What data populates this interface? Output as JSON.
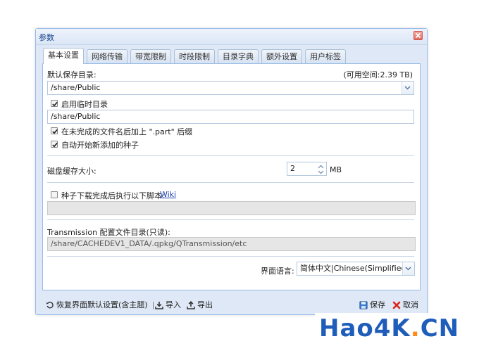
{
  "dialog": {
    "title": "参数"
  },
  "tabs": [
    {
      "label": "基本设置",
      "active": true
    },
    {
      "label": "网络传输",
      "active": false
    },
    {
      "label": "带宽限制",
      "active": false
    },
    {
      "label": "时段限制",
      "active": false
    },
    {
      "label": "目录字典",
      "active": false
    },
    {
      "label": "额外设置",
      "active": false
    },
    {
      "label": "用户标签",
      "active": false
    }
  ],
  "basic": {
    "save_dir_label": "默认保存目录:",
    "free_space": "(可用空间:2.39 TB)",
    "save_dir_value": "/share/Public",
    "temp_dir_label": "启用临时目录",
    "temp_dir_checked": true,
    "temp_dir_value": "/share/Public",
    "part_suffix_label": "在未完成的文件名后加上 \".part\" 后缀",
    "part_suffix_checked": true,
    "auto_start_label": "自动开始新添加的种子",
    "auto_start_checked": true,
    "cache_label": "磁盘缓存大小:",
    "cache_value": "2",
    "cache_unit": "MB",
    "script_label": "种子下载完成后执行以下脚本:",
    "script_checked": false,
    "script_link": "Wiki",
    "script_value": "",
    "config_dir_label": "Transmission 配置文件目录(只读):",
    "config_dir_value": "/share/CACHEDEV1_DATA/.qpkg/QTransmission/etc",
    "language_label": "界面语言:",
    "language_value": "简体中文|Chinese(Simplified)"
  },
  "footer": {
    "reset_label": "恢复界面默认设置(含主题)",
    "import_label": "导入",
    "export_label": "导出",
    "save_label": "保存",
    "cancel_label": "取消"
  },
  "watermark": {
    "text_main": "Hao4K",
    "text_dot": ".",
    "text_tail": "CN"
  },
  "colors": {
    "accent": "#99bbe8",
    "title": "#15428b",
    "link": "#1a3fb0",
    "watermark": "#1f5dbb"
  }
}
